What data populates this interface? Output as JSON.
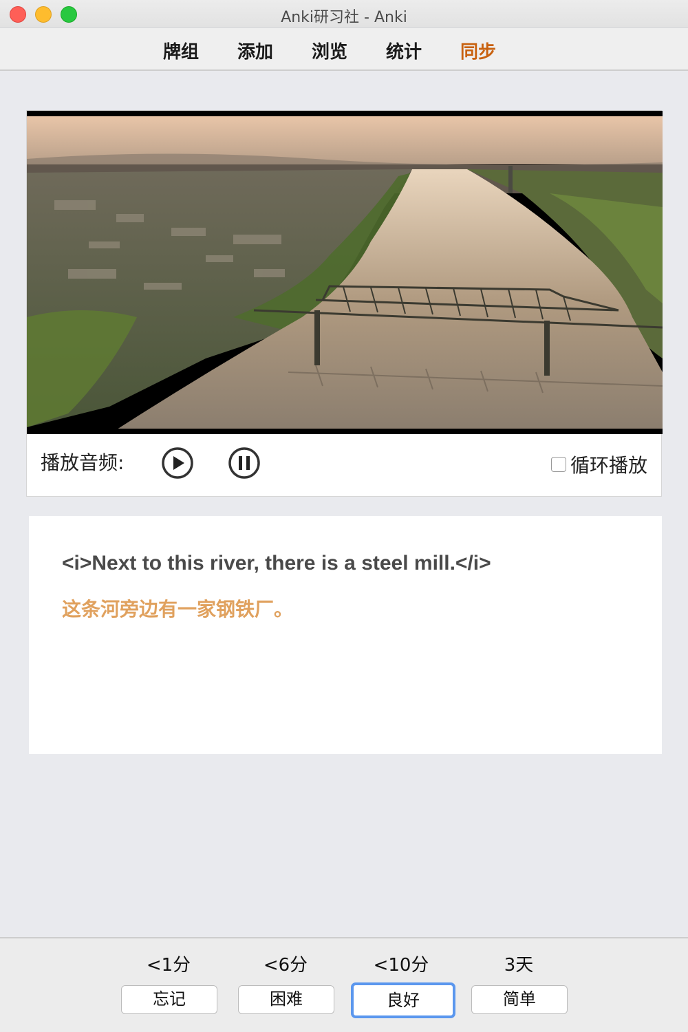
{
  "window": {
    "title": "Anki研习社 - Anki"
  },
  "toolbar": {
    "items": [
      "牌组",
      "添加",
      "浏览",
      "统计",
      "同步"
    ],
    "active": "同步"
  },
  "player": {
    "label": "播放音频:",
    "play_icon": "play-circle-icon",
    "pause_icon": "pause-circle-icon",
    "loop_label": "循环播放",
    "loop_checked": false
  },
  "card": {
    "front": "<i>Next to this river, there is a steel mill.</i>",
    "back": "这条河旁边有一家钢铁厂。"
  },
  "answers": [
    {
      "interval": "<1分",
      "label": "忘记"
    },
    {
      "interval": "<6分",
      "label": "困难"
    },
    {
      "interval": "<10分",
      "label": "良好",
      "focused": true
    },
    {
      "interval": "3天",
      "label": "简单"
    }
  ],
  "colors": {
    "active_nav": "#c8610f",
    "back_text": "#e0a15e",
    "focus_ring": "#5b97ee"
  }
}
